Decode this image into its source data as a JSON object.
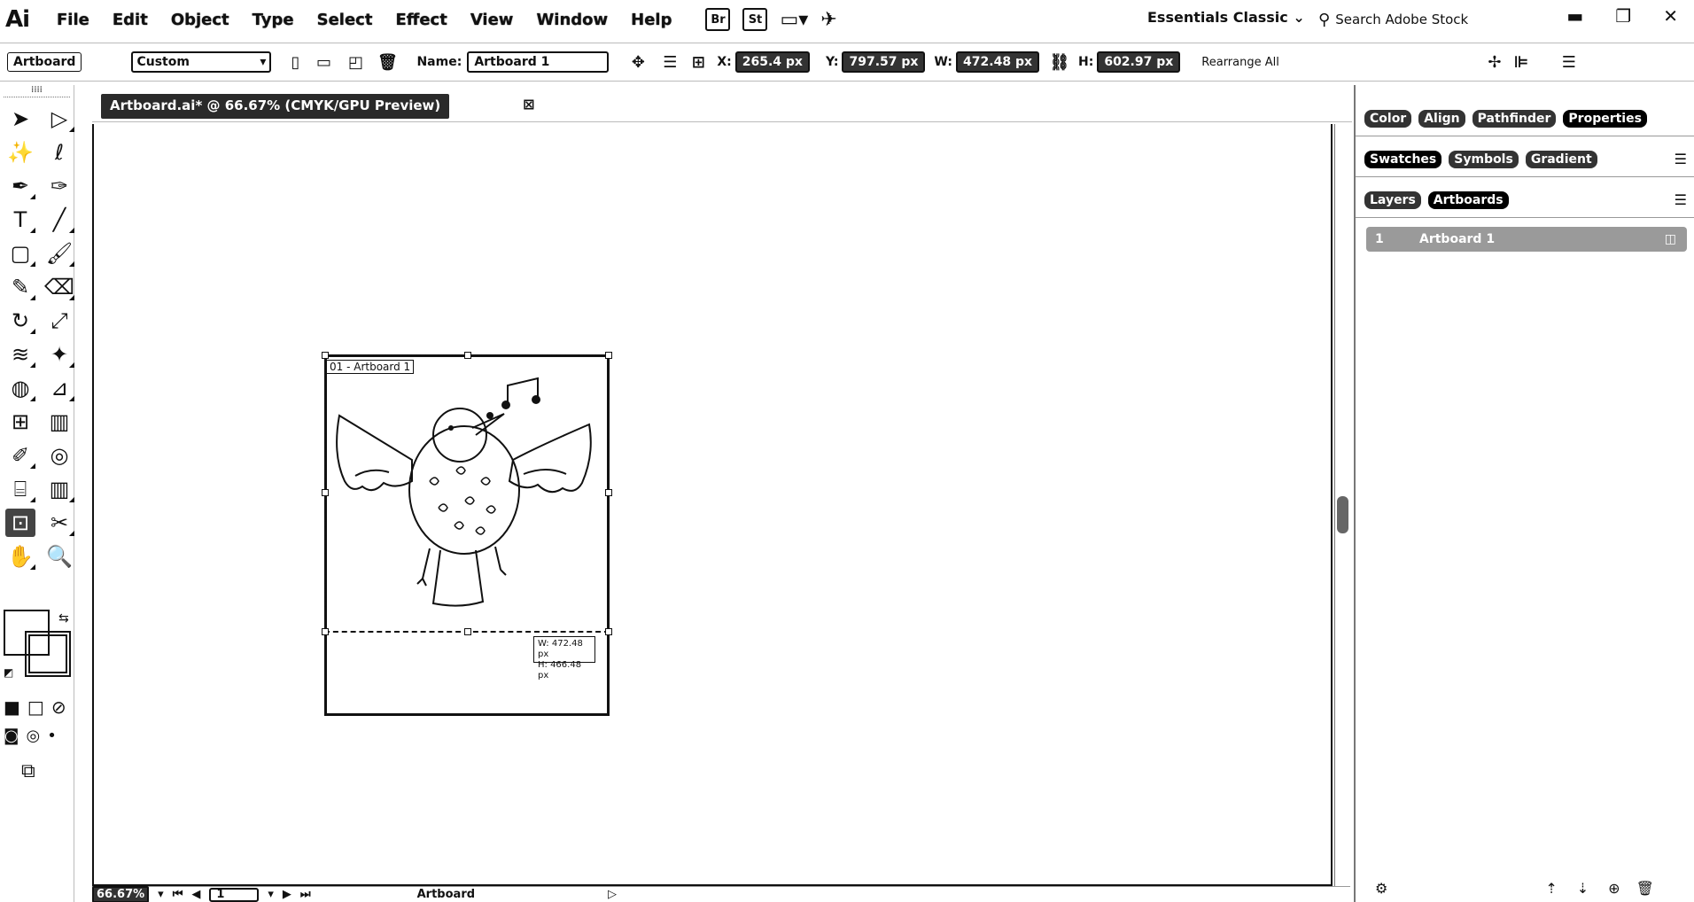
{
  "app": {
    "logo": "Ai"
  },
  "menu": [
    "File",
    "Edit",
    "Object",
    "Type",
    "Select",
    "Effect",
    "View",
    "Window",
    "Help"
  ],
  "app_switchers": {
    "bridge": "Br",
    "stock": "St"
  },
  "workspace": {
    "label": "Essentials Classic"
  },
  "search": {
    "placeholder": "Search Adobe Stock"
  },
  "control": {
    "mode_label": "Artboard",
    "preset_value": "Custom",
    "name_label": "Name:",
    "name_value": "Artboard 1",
    "x_label": "X:",
    "x_value": "265.4 px",
    "y_label": "Y:",
    "y_value": "797.57 px",
    "w_label": "W:",
    "w_value": "472.48 px",
    "h_label": "H:",
    "h_value": "602.97 px",
    "rearrange_label": "Rearrange All"
  },
  "document": {
    "tab_title": "Artboard.ai* @ 66.67% (CMYK/GPU Preview)",
    "artboard_label": "01 - Artboard 1",
    "size_tip_w": "W: 472.48 px",
    "size_tip_h": "H: 466.48 px"
  },
  "status": {
    "zoom": "66.67%",
    "page": "1",
    "tool_name": "Artboard"
  },
  "panels": {
    "group1": [
      "Color",
      "Align",
      "Pathfinder",
      "Properties"
    ],
    "group2": [
      "Swatches",
      "Symbols",
      "Gradient"
    ],
    "group3": [
      "Layers",
      "Artboards"
    ],
    "artboard_list": [
      {
        "index": "1",
        "name": "Artboard 1"
      }
    ]
  },
  "colors": {
    "active_tab": "#000000",
    "artboard_row": "#9a9a9a",
    "selection": "#111111"
  }
}
